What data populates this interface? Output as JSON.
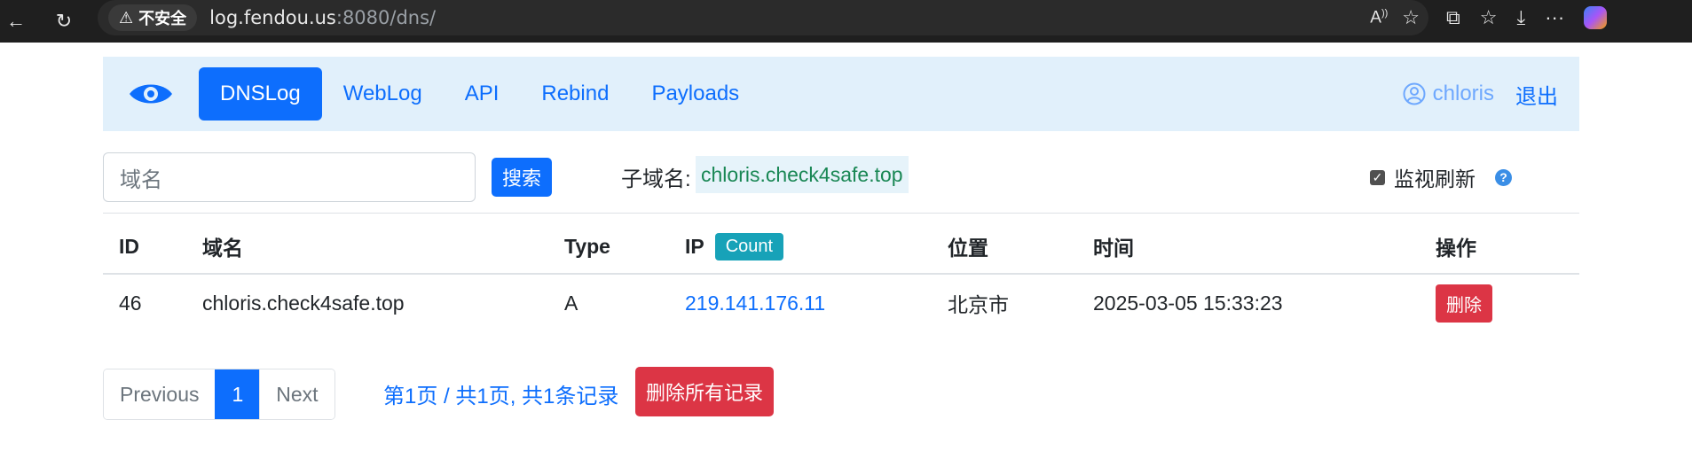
{
  "browser": {
    "security_label": "不安全",
    "url_host": "log.fendou.us",
    "url_rest": ":8080/dns/"
  },
  "navbar": {
    "items": [
      {
        "label": "DNSLog",
        "active": true
      },
      {
        "label": "WebLog"
      },
      {
        "label": "API"
      },
      {
        "label": "Rebind"
      },
      {
        "label": "Payloads"
      }
    ],
    "username": "chloris",
    "logout_label": "退出"
  },
  "search": {
    "placeholder": "域名",
    "button_label": "搜索"
  },
  "subdomain": {
    "label": "子域名:",
    "value": "chloris.check4safe.top"
  },
  "monitor": {
    "label": "监视刷新",
    "checked": true,
    "help": "?"
  },
  "table": {
    "headers": {
      "id": "ID",
      "domain": "域名",
      "type": "Type",
      "ip": "IP",
      "count_badge": "Count",
      "location": "位置",
      "time": "时间",
      "actions": "操作"
    },
    "rows": [
      {
        "id": "46",
        "domain": "chloris.check4safe.top",
        "type": "A",
        "ip": "219.141.176.11",
        "location": "北京市",
        "time": "2025-03-05 15:33:23",
        "action": "删除"
      }
    ]
  },
  "pagination": {
    "previous": "Previous",
    "current": "1",
    "next": "Next",
    "info": "第1页 / 共1页, 共1条记录",
    "delete_all": "删除所有记录"
  },
  "colors": {
    "primary": "#0d6efd",
    "danger": "#dc3545",
    "info": "#17a2b8",
    "navbar_bg": "#e1f0fb"
  }
}
